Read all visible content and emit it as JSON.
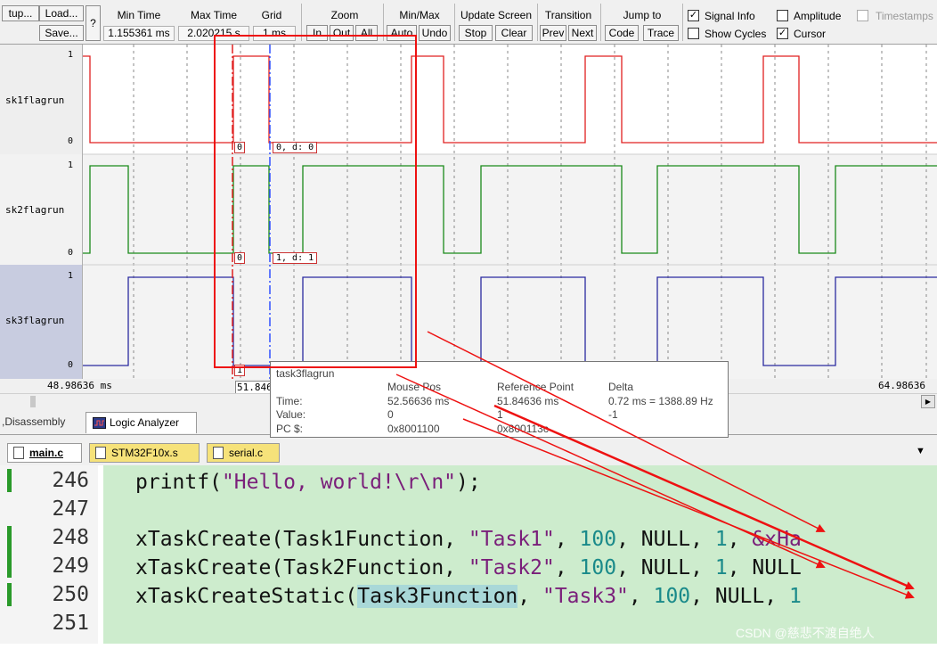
{
  "toolbar": {
    "setup": "tup...",
    "load": "Load...",
    "save": "Save...",
    "help": "?",
    "min_time_label": "Min Time",
    "min_time_value": "1.155361 ms",
    "max_time_label": "Max Time",
    "max_time_value": "2.020215 s",
    "grid_label": "Grid",
    "grid_value": "1 ms",
    "zoom_label": "Zoom",
    "zoom_in": "In",
    "zoom_out": "Out",
    "zoom_all": "All",
    "minmax_label": "Min/Max",
    "minmax_auto": "Auto",
    "minmax_undo": "Undo",
    "update_label": "Update Screen",
    "update_stop": "Stop",
    "update_clear": "Clear",
    "transition_label": "Transition",
    "transition_prev": "Prev",
    "transition_next": "Next",
    "jump_label": "Jump to",
    "jump_code": "Code",
    "jump_trace": "Trace",
    "signal_info": "Signal Info",
    "show_cycles": "Show Cycles",
    "amplitude": "Amplitude",
    "cursor": "Cursor",
    "timestamps": "Timestamps",
    "signal_info_checked": "✓",
    "cursor_checked": "✓"
  },
  "signals": [
    {
      "name": "sk1flagrun",
      "high": "1",
      "low": "0",
      "cursor_val": "0",
      "marker_val": "0,  d: 0"
    },
    {
      "name": "sk2flagrun",
      "high": "1",
      "low": "0",
      "cursor_val": "0",
      "marker_val": "1,  d: 1"
    },
    {
      "name": "sk3flagrun",
      "high": "1",
      "low": "0",
      "cursor_val": "1"
    }
  ],
  "timebar": {
    "left": "48.98636 ms",
    "cursor": "51.846",
    "right": "64.98636"
  },
  "tabs1": {
    "disassembly": "Disassembly",
    "logic_analyzer": "Logic Analyzer"
  },
  "tooltip": {
    "title": "task3flagrun",
    "col_mouse": "Mouse Pos",
    "col_ref": "Reference Point",
    "col_delta": "Delta",
    "row_time": "Time:",
    "row_value": "Value:",
    "row_pc": "PC $:",
    "mouse_time": "52.56636 ms",
    "mouse_value": "0",
    "mouse_pc": "0x8001100",
    "ref_time": "51.84636 ms",
    "ref_value": "1",
    "ref_pc": "0x800113c",
    "delta_time": "0.72 ms = 1388.89 Hz",
    "delta_value": "-1"
  },
  "file_tabs": [
    "main.c",
    "STM32F10x.s",
    "serial.c"
  ],
  "code_lines": [
    {
      "num": "246"
    },
    {
      "num": "247"
    },
    {
      "num": "248"
    },
    {
      "num": "249"
    },
    {
      "num": "250"
    },
    {
      "num": "251"
    }
  ],
  "code": {
    "l246_a": "printf(",
    "l246_b": "\"Hello, world!\\r\\n\"",
    "l246_c": ");",
    "l248_a": "xTaskCreate(Task1Function, ",
    "l248_b": "\"Task1\"",
    "l248_c": ", ",
    "l248_d": "100",
    "l248_e": ", NULL, ",
    "l248_f": "1",
    "l248_g": ", ",
    "l248_h": "&xHa",
    "l249_a": "xTaskCreate(Task2Function, ",
    "l249_b": "\"Task2\"",
    "l249_c": ", ",
    "l249_d": "100",
    "l249_e": ", NULL, ",
    "l249_f": "1",
    "l249_g": ", NULL",
    "l250_a": "xTaskCreateStatic(",
    "l250_b": "Task3Function",
    "l250_c": ", ",
    "l250_d": "\"Task3\"",
    "l250_e": ", ",
    "l250_f": "100",
    "l250_g": ", NULL, ",
    "l250_h": "1"
  },
  "watermark": "CSDN @慈悲不渡自绝人",
  "colors": {
    "sig1": "#e02020",
    "sig2": "#1a8a1a",
    "sig3": "#2a2aa0",
    "annotation": "#ee1111",
    "cursor": "#3050ff"
  }
}
